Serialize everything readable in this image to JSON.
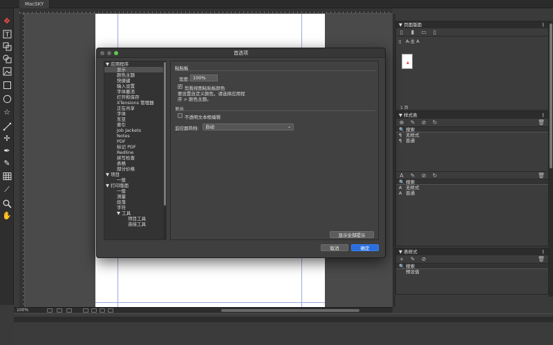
{
  "app": {
    "tab_title": "MacSKY"
  },
  "status": {
    "zoom": "100%"
  },
  "dialog": {
    "title": "首选项",
    "tree": [
      {
        "label": "▼ 应用程序",
        "indent": 0,
        "selected": false
      },
      {
        "label": "显示",
        "indent": 1,
        "selected": true
      },
      {
        "label": "颜色主题",
        "indent": 1,
        "selected": false
      },
      {
        "label": "快捷键",
        "indent": 1,
        "selected": false
      },
      {
        "label": "输入设置",
        "indent": 1,
        "selected": false
      },
      {
        "label": "字体撤消",
        "indent": 1,
        "selected": false
      },
      {
        "label": "打开和保存",
        "indent": 1,
        "selected": false
      },
      {
        "label": "XTensions 管理器",
        "indent": 1,
        "selected": false
      },
      {
        "label": "正在共享",
        "indent": 1,
        "selected": false
      },
      {
        "label": "字体",
        "indent": 1,
        "selected": false
      },
      {
        "label": "东亚",
        "indent": 1,
        "selected": false
      },
      {
        "label": "索引",
        "indent": 1,
        "selected": false
      },
      {
        "label": "Job Jackets",
        "indent": 1,
        "selected": false
      },
      {
        "label": "Notes",
        "indent": 1,
        "selected": false
      },
      {
        "label": "PDF",
        "indent": 1,
        "selected": false
      },
      {
        "label": "标记 PDF",
        "indent": 1,
        "selected": false
      },
      {
        "label": "Redline",
        "indent": 1,
        "selected": false
      },
      {
        "label": "拼写检查",
        "indent": 1,
        "selected": false
      },
      {
        "label": "表格",
        "indent": 1,
        "selected": false
      },
      {
        "label": "部分价格",
        "indent": 1,
        "selected": false
      },
      {
        "label": "▼ 项目",
        "indent": 0,
        "selected": false
      },
      {
        "label": "一般",
        "indent": 1,
        "selected": false
      },
      {
        "label": "▼ 打印版面",
        "indent": 0,
        "selected": false
      },
      {
        "label": "一般",
        "indent": 1,
        "selected": false
      },
      {
        "label": "测量",
        "indent": 1,
        "selected": false
      },
      {
        "label": "段落",
        "indent": 1,
        "selected": false
      },
      {
        "label": "字符",
        "indent": 1,
        "selected": false
      },
      {
        "label": "▼ 工具",
        "indent": 1,
        "selected": false
      },
      {
        "label": "项目工具",
        "indent": 2,
        "selected": false
      },
      {
        "label": "连接工具",
        "indent": 2,
        "selected": false
      }
    ],
    "clipboard_section": "粘贴板",
    "width_label": "宽度:",
    "width_value": "100%",
    "clip_color_label": "剪裁视图粘贴板颜色",
    "clip_note": "要设置自定义颜色，请选择应用程序 > 颜色主题。",
    "display_section": "显示",
    "opaque_label": "不透明文本框编辑",
    "monitor_label": "监控器简档:",
    "monitor_value": "自动",
    "show_all_button": "显示全部提示",
    "cancel_button": "取消",
    "ok_button": "确定"
  },
  "panels": {
    "page_layout": {
      "title": "页面版面",
      "master_label": "A-主 A",
      "page_count": "1 页"
    },
    "styles": {
      "title": "样式表",
      "search1": "搜索",
      "para_items": [
        "无样式",
        "普通"
      ],
      "search2": "搜索",
      "char_items": [
        "无样式",
        "普通"
      ]
    },
    "table_styles": {
      "title": "表样式",
      "search": "搜索",
      "items": [
        "预设值"
      ]
    }
  },
  "colors": {
    "accent": "#2a6fe0",
    "active_tool": "#ff4d4d",
    "traffic_red": "#ee5c55",
    "traffic_yellow": "#f4be4f",
    "traffic_green": "#5fc84f"
  }
}
